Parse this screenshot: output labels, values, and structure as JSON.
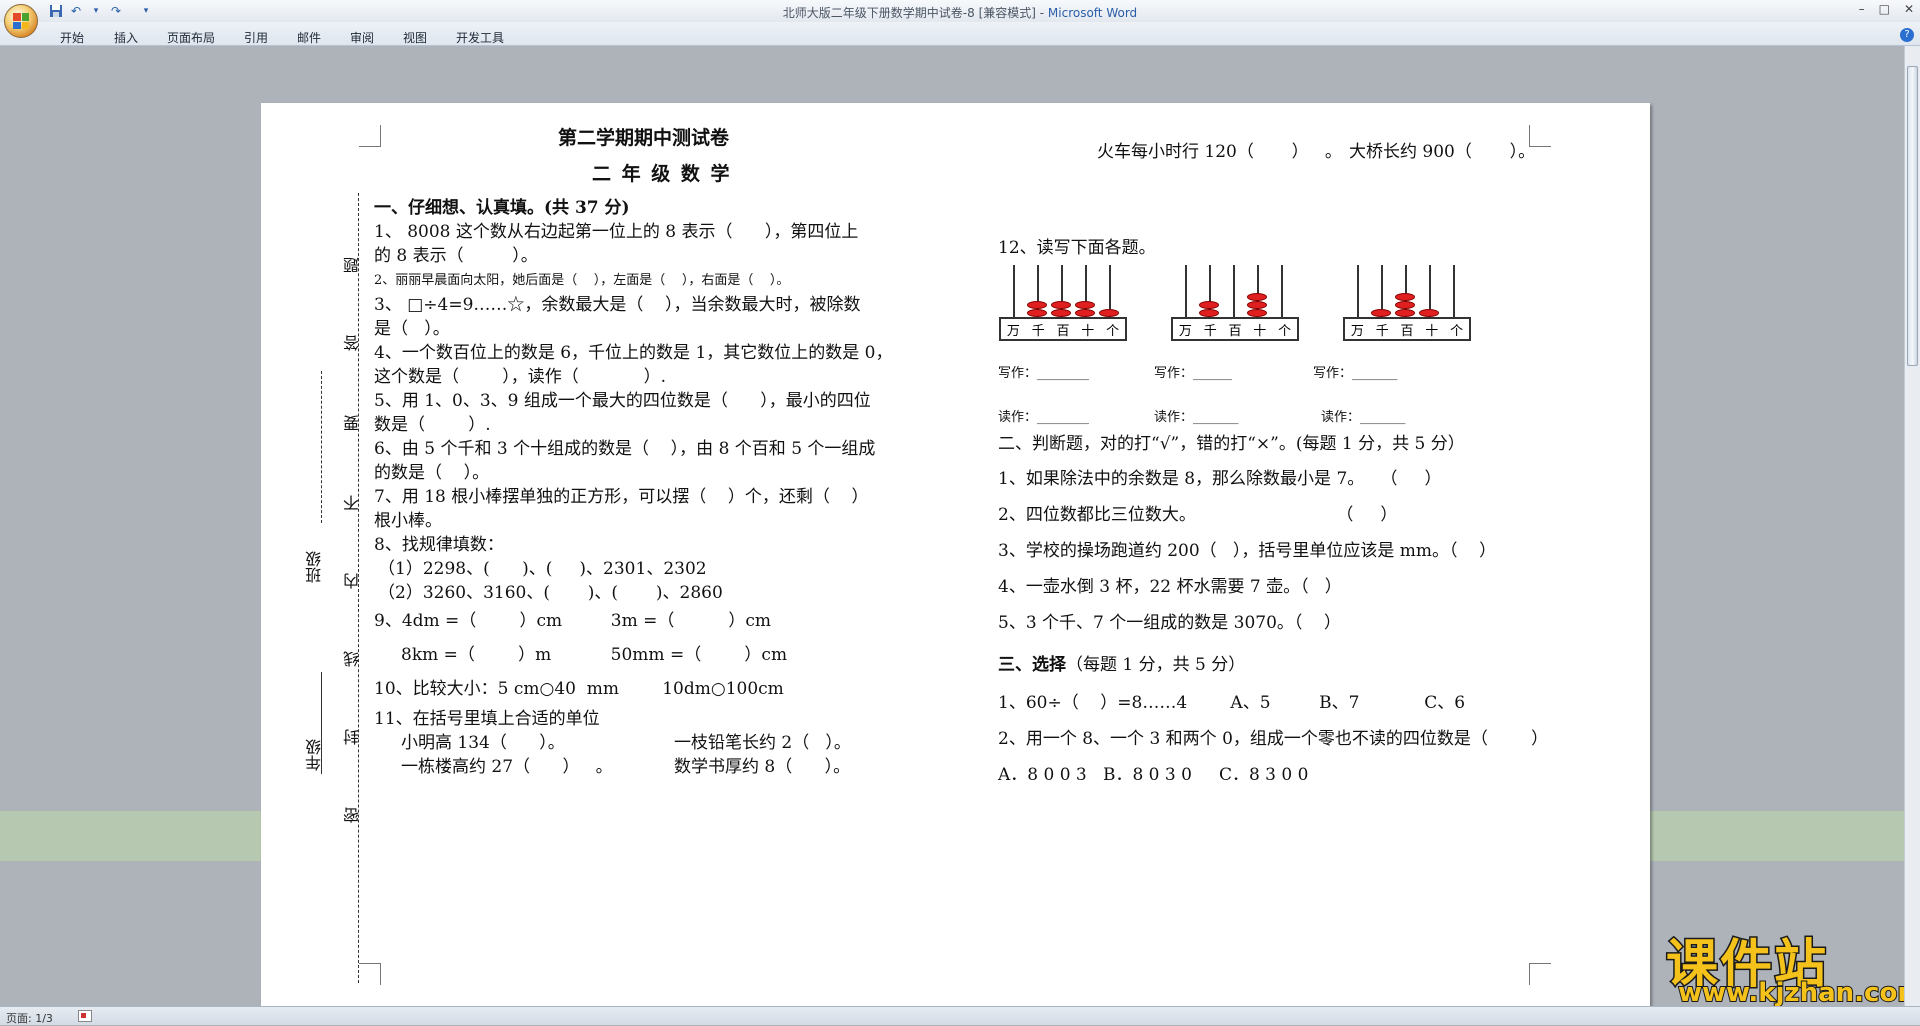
{
  "window": {
    "title": "北师大版二年级下册数学期中试卷-8 [兼容模式] - ",
    "app_name": "Microsoft Word",
    "controls": [
      "–",
      "□",
      "✕"
    ]
  },
  "qat": {
    "save": "save-icon",
    "undo": "↶",
    "redo": "↷",
    "customize": "▾"
  },
  "ribbon": {
    "tabs": [
      "开始",
      "插入",
      "页面布局",
      "引用",
      "邮件",
      "审阅",
      "视图",
      "开发工具"
    ],
    "help": "?"
  },
  "status": {
    "page": "页面: 1/3"
  },
  "watermark": {
    "main": "课件站",
    "url": "www.kjzhan.com"
  },
  "doc": {
    "title1": "第二学期期中测试卷",
    "title2": "二 年 级 数 学",
    "section1": "一、仔细想、认真填。(共 37 分)",
    "q1a": "1、 8008 这个数从右边起第一位上的 8 表示（      ），第四位上",
    "q1b": "的 8 表示（         ）。",
    "q2": "2、丽丽早晨面向太阳，她后面是（    ），左面是（    ），右面是（    ）。",
    "q3a": "3、 □÷4=9……☆，余数最大是（    ），当余数最大时，被除数",
    "q3b": "是（   ）。",
    "q4a": "4、一个数百位上的数是 6，千位上的数是 1，其它数位上的数是 0，",
    "q4b": "这个数是（        ），读作（            ）.",
    "q5a": "5、用 1、0、3、9 组成一个最大的四位数是（      ），最小的四位",
    "q5b": "数是（        ）.",
    "q6a": "6、由 5 个千和 3 个十组成的数是（    ），由 8 个百和 5 个一组成",
    "q6b": "的数是（    ）。",
    "q7a": "7、用 18 根小棒摆单独的正方形，可以摆（    ）个，还剩（    ）",
    "q7b": "根小棒。",
    "q8": "8、找规律填数：",
    "q8a": "（1）2298、(      )、(     )、2301、2302",
    "q8b": "（2）3260、3160、(       )、(       )、2860",
    "q9a": "9、4dm =（        ）cm         3m =（          ）cm",
    "q9b": "8km =（        ）m           50mm =（        ）cm",
    "q10": "10、比较大小：5 cm○40  mm        10dm○100cm",
    "q11": "11、在括号里填上合适的单位",
    "q11a": "小明高 134（      ）。",
    "q11b": "一枝铅笔长约 2（   ）。",
    "q11c": "一栋楼高约 27（      ）   。",
    "q11d": "数学书厚约 8（      ）。",
    "r_top1": "火车每小时行 120（       ）   。",
    "r_top2": "大桥长约 900（       ）。",
    "q12": "12、读写下面各题。",
    "abacus_label": [
      "万",
      "千",
      "百",
      "十",
      "个"
    ],
    "write1": "写作：________",
    "write2": "写作：______",
    "write3": "写作：_______",
    "read1": "读作：________",
    "read2": "读作：_______",
    "read3": "读作：_______",
    "section2": "二、判断题，对的打“√”，错的打“×”。(每题 1 分，共 5 分）",
    "j1": "1、如果除法中的余数是 8，那么除数最小是 7。   （     ）",
    "j2": "2、四位数都比三位数大。                          （     ）",
    "j3": "3、学校的操场跑道约 200（   ），括号里单位应该是 mm。（    ）",
    "j4": "4、一壶水倒 3 杯，22 杯水需要 7 壶。（   ）",
    "j5": "5、3 个千、7 个一组成的数是 3070。（    ）",
    "section3_bold": "三、选择",
    "section3_rest": "（每题 1 分，共 5 分）",
    "c1": "1、60÷（    ）=8……4        A、5         B、7            C、6",
    "c2": "2、用一个 8、一个 3 和两个 0，组成一个零也不读的四位数是（        ）",
    "c2opts": "A．8 0 0 3   B．8 0 3 0     C．8 3 0 0",
    "side_class": "班级",
    "side_grade": "年级",
    "side_seal": [
      "题",
      "答",
      "要",
      "不",
      "内",
      "线",
      "封",
      "密"
    ]
  }
}
